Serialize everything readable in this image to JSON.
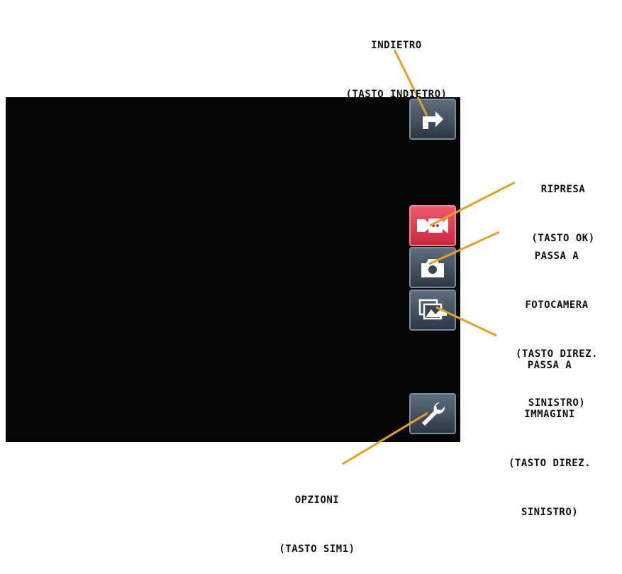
{
  "labels": {
    "back": {
      "line1": "INDIETRO",
      "line2": "(TASTO INDIETRO)"
    },
    "record": {
      "line1": "RIPRESA",
      "line2": "(TASTO OK)"
    },
    "camera": {
      "line1": "PASSA A",
      "line2": "FOTOCAMERA",
      "line3": "(TASTO DIREZ.",
      "line4": "SINISTRO)"
    },
    "images": {
      "line1": "PASSA A",
      "line2": "IMMAGINI",
      "line3": "(TASTO DIREZ.",
      "line4": "SINISTRO)"
    },
    "options": {
      "line1": "OPZIONI",
      "line2": "(TASTO SIM1)"
    }
  },
  "icons": {
    "back": "back-arrow-icon",
    "record": "video-camera-icon",
    "camera": "camera-icon",
    "images": "gallery-icon",
    "options": "wrench-icon"
  },
  "colors": {
    "leader_line": "#e8a020",
    "active_button": "#e0364a",
    "button": "#3c4a58"
  }
}
